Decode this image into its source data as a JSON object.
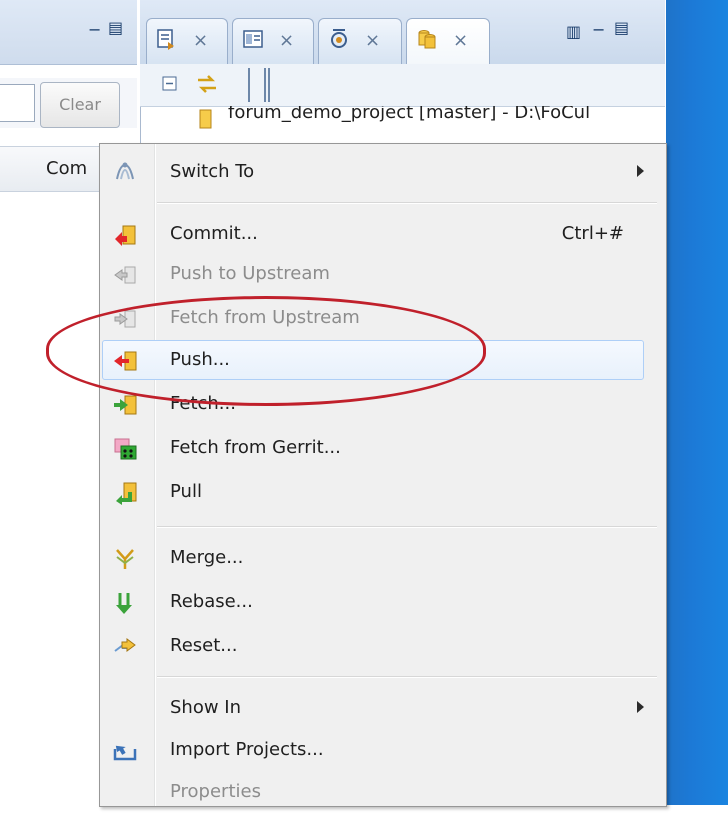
{
  "left_view": {
    "clear_button_label": "Clear",
    "column_header_fragment": "Com"
  },
  "tabs": [
    {
      "icon": "synchronize-icon"
    },
    {
      "icon": "history-icon"
    },
    {
      "icon": "staging-icon"
    },
    {
      "icon": "repositories-icon"
    }
  ],
  "tree": {
    "node_label": "forum_demo_project [master] - D:\\FoCul"
  },
  "context_menu": {
    "items": [
      {
        "label": "Switch To",
        "icon": "switch-to-icon",
        "submenu": true,
        "enabled": true
      },
      {
        "label": "Commit...",
        "icon": "commit-icon",
        "shortcut": "Ctrl+#",
        "enabled": true
      },
      {
        "label": "Push to Upstream",
        "icon": "push-upstream-icon",
        "enabled": false
      },
      {
        "label": "Fetch from Upstream",
        "icon": "fetch-upstream-icon",
        "enabled": false
      },
      {
        "label": "Push...",
        "icon": "push-icon",
        "enabled": true,
        "highlighted": true
      },
      {
        "label": "Fetch...",
        "icon": "fetch-icon",
        "enabled": true
      },
      {
        "label": "Fetch from Gerrit...",
        "icon": "gerrit-icon",
        "enabled": true
      },
      {
        "label": "Pull",
        "icon": "pull-icon",
        "enabled": true
      },
      {
        "label": "Merge...",
        "icon": "merge-icon",
        "enabled": true
      },
      {
        "label": "Rebase...",
        "icon": "rebase-icon",
        "enabled": true
      },
      {
        "label": "Reset...",
        "icon": "reset-icon",
        "enabled": true
      },
      {
        "label": "Show In",
        "submenu": true,
        "enabled": true
      },
      {
        "label": "Import Projects...",
        "icon": "import-projects-icon",
        "enabled": true
      },
      {
        "label": "Properties",
        "enabled": false
      }
    ]
  },
  "annotation": {
    "color": "#c0202b",
    "target": "Push..."
  },
  "colors": {
    "desktop_blue": "#1c79d6",
    "highlight_border": "#aecff7"
  }
}
